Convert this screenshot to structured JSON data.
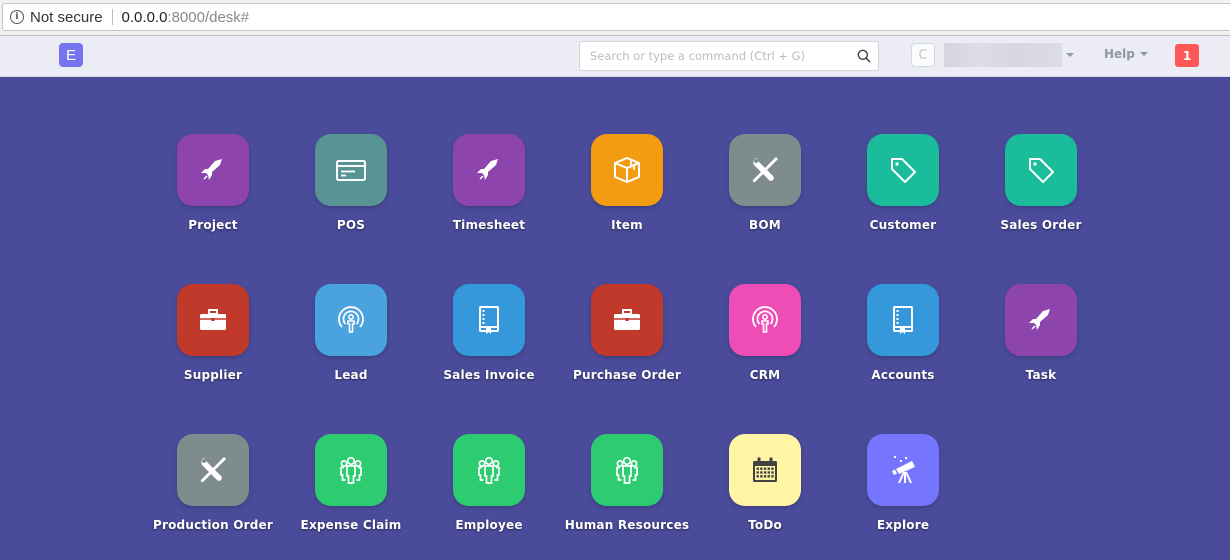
{
  "browser": {
    "security_label": "Not secure",
    "url_host": "0.0.0.0",
    "url_rest": ":8000/desk#"
  },
  "navbar": {
    "logo_letter": "E",
    "search_placeholder": "Search or type a command (Ctrl + G)",
    "search_value": "",
    "avatar_initial": "C",
    "user_name": "",
    "help_label": "Help",
    "notification_count": "1"
  },
  "modules": [
    {
      "label": "Project",
      "icon": "rocket-icon",
      "color": "#8e44ad"
    },
    {
      "label": "POS",
      "icon": "credit-card-icon",
      "color": "#589494"
    },
    {
      "label": "Timesheet",
      "icon": "rocket-icon",
      "color": "#8e44ad"
    },
    {
      "label": "Item",
      "icon": "box-icon",
      "color": "#f39c12"
    },
    {
      "label": "BOM",
      "icon": "tools-icon",
      "color": "#7f8c8d"
    },
    {
      "label": "Customer",
      "icon": "tag-icon",
      "color": "#1abc9c"
    },
    {
      "label": "Sales Order",
      "icon": "tag-icon",
      "color": "#1abc9c"
    },
    {
      "label": "Supplier",
      "icon": "briefcase-icon",
      "color": "#c0392b"
    },
    {
      "label": "Lead",
      "icon": "broadcast-icon",
      "color": "#4aa3df"
    },
    {
      "label": "Sales Invoice",
      "icon": "book-icon",
      "color": "#3498db"
    },
    {
      "label": "Purchase Order",
      "icon": "briefcase-icon",
      "color": "#c0392b"
    },
    {
      "label": "CRM",
      "icon": "broadcast-icon",
      "color": "#ef4db6"
    },
    {
      "label": "Accounts",
      "icon": "book-icon",
      "color": "#3498db"
    },
    {
      "label": "Task",
      "icon": "rocket-icon",
      "color": "#8e44ad"
    },
    {
      "label": "Production Order",
      "icon": "tools-icon",
      "color": "#7f8c8d"
    },
    {
      "label": "Expense Claim",
      "icon": "people-icon",
      "color": "#2ecc71"
    },
    {
      "label": "Employee",
      "icon": "people-icon",
      "color": "#2ecc71"
    },
    {
      "label": "Human Resources",
      "icon": "people-icon",
      "color": "#2ecc71"
    },
    {
      "label": "ToDo",
      "icon": "calendar-icon",
      "color": "#fff5a5",
      "icon_color": "#424242"
    },
    {
      "label": "Explore",
      "icon": "telescope-icon",
      "color": "#7575ff"
    }
  ]
}
